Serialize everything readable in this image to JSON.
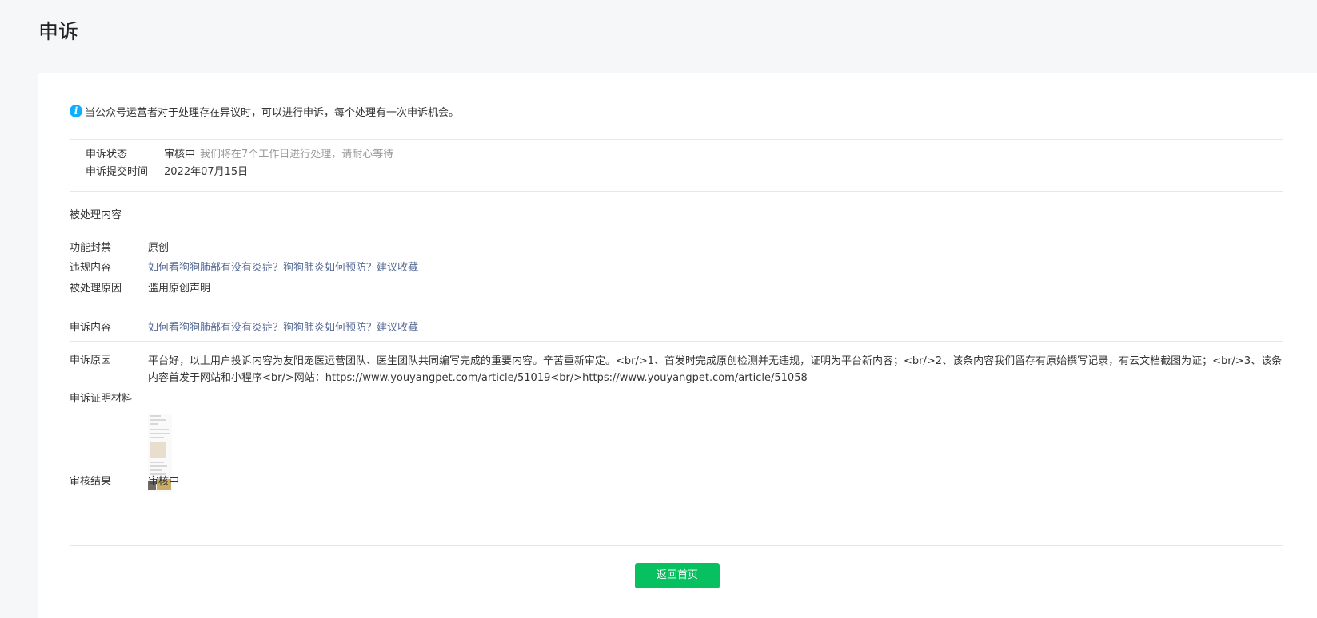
{
  "page": {
    "title": "申诉"
  },
  "notice": {
    "icon": "info-icon",
    "icon_glyph": "i",
    "text": "当公众号运营者对于处理存在异议时，可以进行申诉，每个处理有一次申诉机会。"
  },
  "status": {
    "state_label": "申诉状态",
    "state_value": "审核中",
    "state_tip": "我们将在7个工作日进行处理，请耐心等待",
    "submit_label": "申诉提交时间",
    "submit_value": "2022年07月15日"
  },
  "processed": {
    "section_title": "被处理内容",
    "ban_label": "功能封禁",
    "ban_value": "原创",
    "violation_label": "违规内容",
    "violation_value": "如何看狗狗肺部有没有炎症？狗狗肺炎如何预防？建议收藏",
    "reason_label": "被处理原因",
    "reason_value": "滥用原创声明"
  },
  "appeal": {
    "content_label": "申诉内容",
    "content_value": "如何看狗狗肺部有没有炎症？狗狗肺炎如何预防？建议收藏",
    "reason_label": "申诉原因",
    "reason_value": "平台好，以上用户投诉内容为友阳宠医运营团队、医生团队共同编写完成的重要内容。辛苦重新审定。<br/>1、首发时完成原创检测并无违规，证明为平台新内容；<br/>2、该条内容我们留存有原始撰写记录，有云文档截图为证；<br/>3、该条内容首发于网站和小程序<br/>网站：https://www.youyangpet.com/article/51019<br/>https://www.youyangpet.com/article/51058",
    "evidence_label": "申诉证明材料",
    "result_label": "审核结果",
    "result_value": "审核中"
  },
  "actions": {
    "home_button": "返回首页"
  },
  "colors": {
    "accent_green": "#07c160",
    "link_blue": "#576b95",
    "info_blue": "#10aeff"
  }
}
